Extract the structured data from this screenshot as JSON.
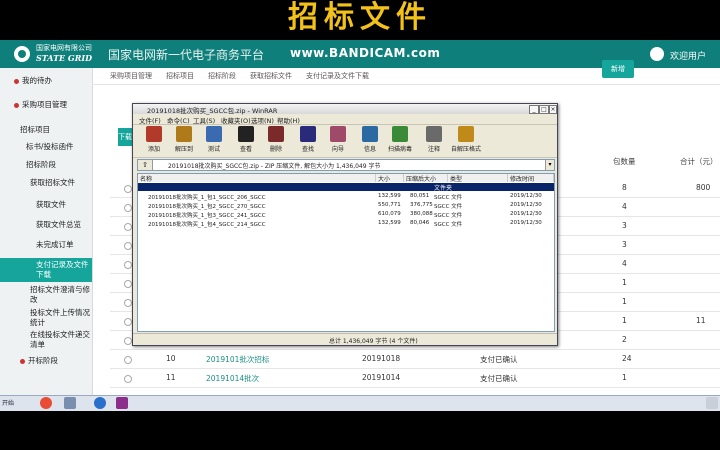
{
  "caption": "招标文件",
  "header": {
    "logo_cn": "国家电网有限公司",
    "logo_en": "STATE GRID",
    "platform": "国家电网新一代电子商务平台",
    "watermark": "www.BANDICAM.com",
    "user": "欢迎用户"
  },
  "sidebar": {
    "items": [
      {
        "label": "我的待办",
        "dot": true
      },
      {
        "label": "采购项目管理",
        "dot": true
      },
      {
        "label": "招标项目",
        "dot": false
      },
      {
        "label": "标书/投标函件",
        "dot": false
      },
      {
        "label": "招标阶段",
        "dot": false
      },
      {
        "label": "获取招标文件",
        "dot": false
      },
      {
        "label": "获取文件",
        "dot": false
      },
      {
        "label": "获取文件总览",
        "dot": false
      },
      {
        "label": "未完成订单",
        "dot": false
      },
      {
        "label": "支付记录及文件下载",
        "dot": false
      },
      {
        "label": "招标文件澄清与修改",
        "dot": false
      },
      {
        "label": "投标文件上传情况统计",
        "dot": false
      },
      {
        "label": "在线投标文件递交清单",
        "dot": false
      },
      {
        "label": "开标阶段",
        "dot": true
      }
    ]
  },
  "breadcrumb": [
    "采购项目管理",
    "招标项目",
    "招标阶段",
    "获取招标文件",
    "支付记录及文件下载"
  ],
  "main": {
    "new_button": "新增",
    "add_button": "下载",
    "columns": {
      "package_count": "包数量",
      "total": "合计（元）"
    },
    "rows": [
      {
        "pkg": "8",
        "total": "800"
      },
      {
        "pkg": "4",
        "total": ""
      },
      {
        "pkg": "3",
        "total": ""
      },
      {
        "pkg": "3",
        "total": ""
      },
      {
        "pkg": "4",
        "total": ""
      },
      {
        "pkg": "1",
        "total": ""
      },
      {
        "pkg": "1",
        "total": ""
      },
      {
        "pkg": "1",
        "total": "11"
      },
      {
        "num": "",
        "name": "2019100批次",
        "code": "201910",
        "status": "支付已确认",
        "pkg": "2",
        "total": ""
      },
      {
        "num": "10",
        "name": "2019101批次招标",
        "code": "20191018",
        "status": "支付已确认",
        "pkg": "24",
        "total": ""
      },
      {
        "num": "11",
        "name": "20191014批次",
        "code": "20191014",
        "status": "支付已确认",
        "pkg": "1",
        "total": ""
      }
    ]
  },
  "rar": {
    "title": "20191018批次购买_SGCC包.zip - WinRAR",
    "menu": [
      "文件(F)",
      "命令(C)",
      "工具(S)",
      "收藏夹(O)",
      "选项(N)",
      "帮助(H)"
    ],
    "tools": [
      "添加",
      "解压到",
      "测试",
      "查看",
      "删除",
      "查找",
      "向导",
      "信息",
      "扫描病毒",
      "注释",
      "自解压格式"
    ],
    "path": "20191018批次购买_SGCC包.zip - ZIP 压缩文件, 解包大小为 1,436,049 字节",
    "list_headers": [
      "名称",
      "大小",
      "压缩后大小",
      "类型",
      "修改时间"
    ],
    "selected_type": "文件夹",
    "files": [
      {
        "name": "20191018批次购买_1_包1_SGCC_206_SGCC",
        "size": "132,599",
        "packed": "80,051",
        "type": "SGCC 文件",
        "date": "2019/12/30"
      },
      {
        "name": "20191018批次购买_1_包2_SGCC_270_SGCC",
        "size": "550,771",
        "packed": "376,775",
        "type": "SGCC 文件",
        "date": "2019/12/30"
      },
      {
        "name": "20191018批次购买_1_包3_SGCC_241_SGCC",
        "size": "610,079",
        "packed": "380,088",
        "type": "SGCC 文件",
        "date": "2019/12/30"
      },
      {
        "name": "20191018批次购买_1_包4_SGCC_214_SGCC",
        "size": "132,599",
        "packed": "80,046",
        "type": "SGCC 文件",
        "date": "2019/12/30"
      }
    ],
    "status_left": "",
    "status_right": "总计 1,436,049 字节 (4 个文件)"
  },
  "taskbar": {
    "start": "开始"
  },
  "colors": {
    "brand": "#0e7f7a",
    "accent": "#15a59b",
    "caption": "#f2c21b"
  }
}
